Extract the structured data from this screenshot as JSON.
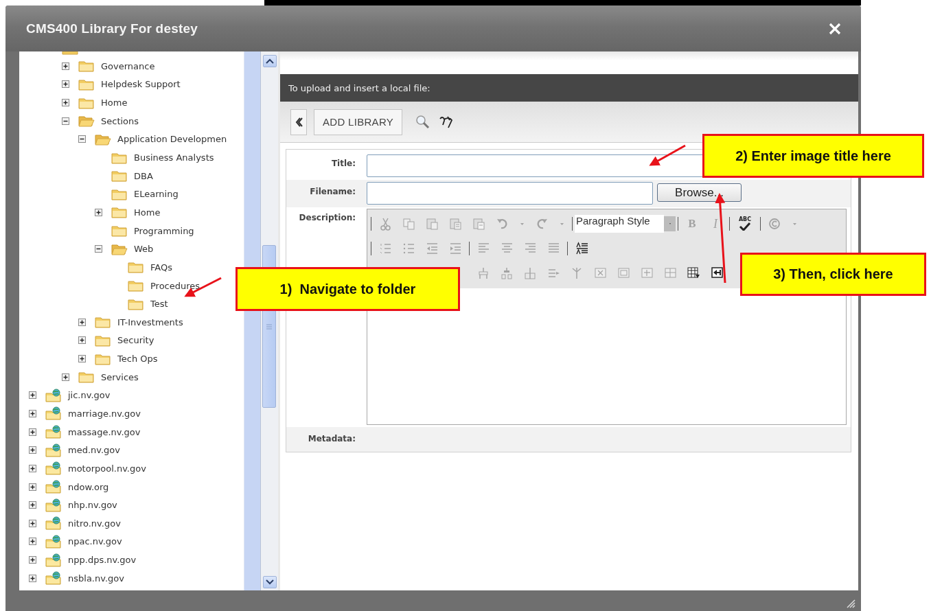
{
  "window": {
    "title": "CMS400 Library For destey"
  },
  "tree": {
    "items": [
      {
        "kind": "clipped",
        "children": [
          {
            "kind": "folder",
            "label": "Governance",
            "expanded": false
          },
          {
            "kind": "folder",
            "label": "Helpdesk Support",
            "expanded": false
          },
          {
            "kind": "folder",
            "label": "Home",
            "expanded": false
          },
          {
            "kind": "folder",
            "label": "Sections",
            "expanded": true,
            "children": [
              {
                "kind": "folder",
                "label": "Application Developmen",
                "expanded": true,
                "children": [
                  {
                    "kind": "folder",
                    "label": "Business Analysts"
                  },
                  {
                    "kind": "folder",
                    "label": "DBA"
                  },
                  {
                    "kind": "folder",
                    "label": "ELearning"
                  },
                  {
                    "kind": "folder",
                    "label": "Home",
                    "expanded": false
                  },
                  {
                    "kind": "folder",
                    "label": "Programming"
                  },
                  {
                    "kind": "folder",
                    "label": "Web",
                    "expanded": true,
                    "children": [
                      {
                        "kind": "folder",
                        "label": "FAQs"
                      },
                      {
                        "kind": "folder",
                        "label": "Procedures"
                      },
                      {
                        "kind": "folder",
                        "label": "Test"
                      }
                    ]
                  }
                ]
              },
              {
                "kind": "folder",
                "label": "IT-Investments",
                "expanded": false
              },
              {
                "kind": "folder",
                "label": "Security",
                "expanded": false
              },
              {
                "kind": "folder",
                "label": "Tech Ops",
                "expanded": false
              }
            ]
          },
          {
            "kind": "folder",
            "label": "Services",
            "expanded": false
          }
        ]
      },
      {
        "kind": "site",
        "label": "jic.nv.gov",
        "expanded": false
      },
      {
        "kind": "site",
        "label": "marriage.nv.gov",
        "expanded": false
      },
      {
        "kind": "site",
        "label": "massage.nv.gov",
        "expanded": false
      },
      {
        "kind": "site",
        "label": "med.nv.gov",
        "expanded": false
      },
      {
        "kind": "site",
        "label": "motorpool.nv.gov",
        "expanded": false
      },
      {
        "kind": "site",
        "label": "ndow.org",
        "expanded": false
      },
      {
        "kind": "site",
        "label": "nhp.nv.gov",
        "expanded": false
      },
      {
        "kind": "site",
        "label": "nitro.nv.gov",
        "expanded": false
      },
      {
        "kind": "site",
        "label": "npac.nv.gov",
        "expanded": false
      },
      {
        "kind": "site",
        "label": "npp.dps.nv.gov",
        "expanded": false
      },
      {
        "kind": "site",
        "label": "nsbla.nv.gov",
        "expanded": false
      }
    ]
  },
  "upload": {
    "header": "To upload and insert a local file:",
    "add_library": "ADD LIBRARY",
    "fields": [
      {
        "kind": "text",
        "label": "Title:"
      },
      {
        "kind": "file",
        "label": "Filename:",
        "button": "Browse..."
      },
      {
        "kind": "editor",
        "label": "Description:"
      },
      {
        "kind": "static",
        "label": "Metadata:"
      }
    ],
    "editor_toolbar": [
      [
        {
          "kind": "sep"
        },
        {
          "kind": "cut",
          "disabled": true
        },
        {
          "kind": "copy",
          "disabled": true
        },
        {
          "kind": "paste",
          "disabled": true
        },
        {
          "kind": "paste-text",
          "disabled": true
        },
        {
          "kind": "paste-word",
          "disabled": true
        },
        {
          "kind": "undo",
          "disabled": true
        },
        {
          "kind": "caret",
          "disabled": true
        },
        {
          "kind": "redo",
          "disabled": true
        },
        {
          "kind": "caret",
          "disabled": true
        },
        {
          "kind": "sep"
        },
        {
          "kind": "select",
          "text": "Paragraph Style"
        },
        {
          "kind": "sep"
        },
        {
          "kind": "bold",
          "text": "B",
          "disabled": true
        },
        {
          "kind": "italic",
          "text": "I",
          "disabled": true
        },
        {
          "kind": "sep"
        },
        {
          "kind": "spellcheck",
          "text": "ABC",
          "disabled": false
        },
        {
          "kind": "sep"
        },
        {
          "kind": "copyright",
          "disabled": true
        },
        {
          "kind": "caret",
          "disabled": true
        }
      ],
      [
        {
          "kind": "sep"
        },
        {
          "kind": "ordered-list",
          "disabled": true
        },
        {
          "kind": "bullet-list",
          "disabled": true
        },
        {
          "kind": "outdent",
          "disabled": true
        },
        {
          "kind": "indent",
          "disabled": true
        },
        {
          "kind": "sep"
        },
        {
          "kind": "align-left",
          "disabled": true
        },
        {
          "kind": "align-center",
          "disabled": true
        },
        {
          "kind": "align-right",
          "disabled": true
        },
        {
          "kind": "justify",
          "disabled": true
        },
        {
          "kind": "sep"
        },
        {
          "kind": "line-spacing",
          "disabled": false
        }
      ],
      [
        {
          "kind": "table-rows",
          "disabled": true
        },
        {
          "kind": "table-split",
          "disabled": true
        },
        {
          "kind": "table-merge",
          "disabled": true
        },
        {
          "kind": "table-col",
          "disabled": true
        },
        {
          "kind": "table-fork",
          "disabled": true
        },
        {
          "kind": "cell-delete",
          "disabled": true
        },
        {
          "kind": "cell-props",
          "disabled": true
        },
        {
          "kind": "cell-insert",
          "disabled": true
        },
        {
          "kind": "cell-grid",
          "disabled": true
        },
        {
          "kind": "table-insert",
          "disabled": false
        },
        {
          "kind": "table-import",
          "disabled": false
        }
      ]
    ]
  },
  "annotations": [
    {
      "text": "1)  Navigate to folder"
    },
    {
      "text": "2) Enter image title here"
    },
    {
      "text": "3) Then, click here"
    }
  ]
}
